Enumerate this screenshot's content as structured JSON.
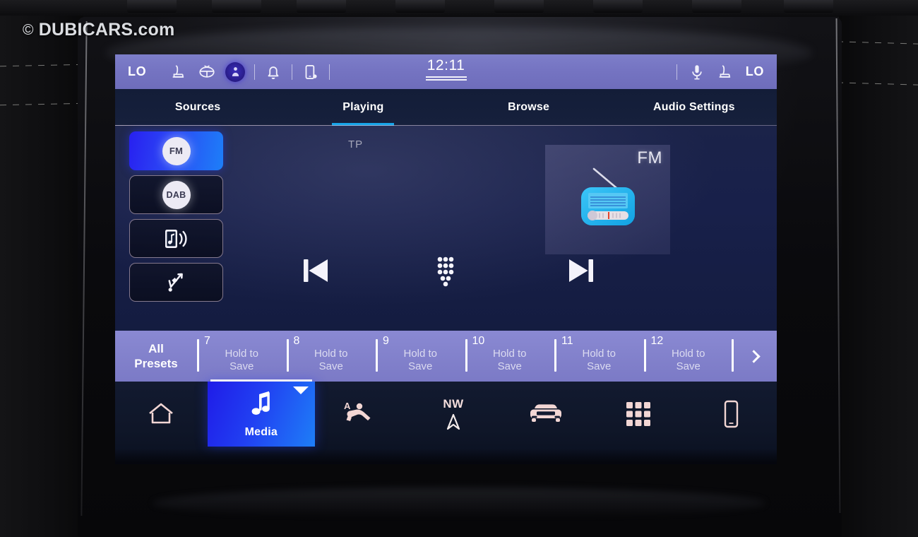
{
  "watermark": {
    "copyright": "©",
    "text": "DUBICARS.com"
  },
  "status_bar": {
    "left_temp": "LO",
    "right_temp": "LO",
    "clock": "12:11",
    "left_icons": [
      {
        "name": "heated-seat-left-icon",
        "label": "Heated Seat Left"
      },
      {
        "name": "heated-steering-wheel-icon",
        "label": "Heated Steering Wheel"
      },
      {
        "name": "user-profile-icon",
        "label": "User Profile"
      },
      {
        "name": "notifications-bell-icon",
        "label": "Notifications"
      },
      {
        "name": "phone-settings-icon",
        "label": "Phone Settings"
      }
    ],
    "right_icons": [
      {
        "name": "microphone-icon",
        "label": "Voice Command"
      },
      {
        "name": "heated-seat-right-icon",
        "label": "Heated Seat Right"
      }
    ]
  },
  "tabs": [
    {
      "label": "Sources",
      "active": false
    },
    {
      "label": "Playing",
      "active": true
    },
    {
      "label": "Browse",
      "active": false
    },
    {
      "label": "Audio Settings",
      "active": false
    }
  ],
  "sources": [
    {
      "id": "fm",
      "label": "FM",
      "type": "pill",
      "active": true
    },
    {
      "id": "dab",
      "label": "DAB",
      "type": "pill",
      "active": false
    },
    {
      "id": "bluetooth-audio",
      "label": "Bluetooth Audio",
      "type": "icon",
      "icon": "phone-music-icon",
      "active": false
    },
    {
      "id": "usb",
      "label": "USB",
      "type": "icon",
      "icon": "usb-icon",
      "active": false
    }
  ],
  "now_playing": {
    "tp_indicator": "TP",
    "artwork_label": "FM",
    "artwork_icon": "radio-icon"
  },
  "transport": [
    {
      "name": "previous-track-button",
      "label": "Previous"
    },
    {
      "name": "direct-tune-keypad-button",
      "label": "Keypad"
    },
    {
      "name": "next-track-button",
      "label": "Next"
    }
  ],
  "presets": {
    "all_presets_line1": "All",
    "all_presets_line2": "Presets",
    "hold_line1": "Hold to",
    "hold_line2": "Save",
    "items": [
      {
        "number": "7",
        "text_line1": "Hold to",
        "text_line2": "Save"
      },
      {
        "number": "8",
        "text_line1": "Hold to",
        "text_line2": "Save"
      },
      {
        "number": "9",
        "text_line1": "Hold to",
        "text_line2": "Save"
      },
      {
        "number": "10",
        "text_line1": "Hold to",
        "text_line2": "Save"
      },
      {
        "number": "11",
        "text_line1": "Hold to",
        "text_line2": "Save"
      },
      {
        "number": "12",
        "text_line1": "Hold to",
        "text_line2": "Save"
      }
    ],
    "next_page_label": "›"
  },
  "nav_bar": {
    "items": [
      {
        "id": "home",
        "icon": "home-icon",
        "label": ""
      },
      {
        "id": "media",
        "icon": "music-note-icon",
        "label": "Media",
        "active": true
      },
      {
        "id": "climate",
        "icon": "seat-climate-icon",
        "label": ""
      },
      {
        "id": "navigation",
        "icon": "compass-arrow-icon",
        "label": "",
        "direction": "NW"
      },
      {
        "id": "vehicle",
        "icon": "car-front-icon",
        "label": ""
      },
      {
        "id": "apps",
        "icon": "apps-grid-icon",
        "label": ""
      },
      {
        "id": "phone",
        "icon": "phone-icon",
        "label": ""
      }
    ]
  },
  "colors": {
    "status_bar": "#7574c2",
    "preset_bar": "#8483cd",
    "accent_blue": "#17a4e8",
    "active_tile_blue": "#2140f2",
    "content_navy": "#18204a",
    "nav_icon_pink": "#f2d6d4"
  }
}
